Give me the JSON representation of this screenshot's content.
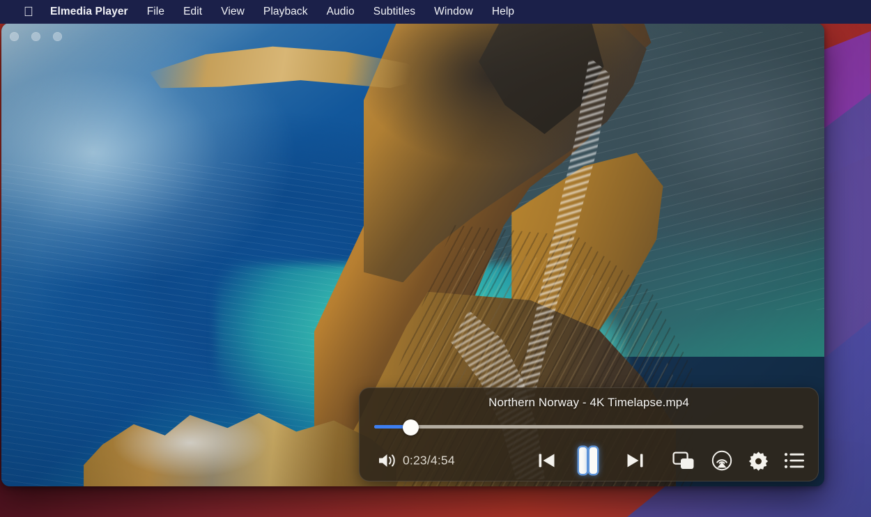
{
  "menubar": {
    "apple_icon": "apple-logo",
    "app_name": "Elmedia Player",
    "items": [
      {
        "label": "File"
      },
      {
        "label": "Edit"
      },
      {
        "label": "View"
      },
      {
        "label": "Playback"
      },
      {
        "label": "Audio"
      },
      {
        "label": "Subtitles"
      },
      {
        "label": "Window"
      },
      {
        "label": "Help"
      }
    ],
    "background_color": "#1b2049",
    "text_color": "#f2f3f7"
  },
  "window": {
    "traffic_lights": [
      "close",
      "minimize",
      "zoom"
    ],
    "video_description": "Aerial view of a Northern Norway coastline with deep blue water, turquoise shallows and golden cliffs"
  },
  "controls": {
    "title": "Northern Norway - 4K Timelapse.mp4",
    "seek": {
      "progress_percent": 8.5,
      "fill_color": "#3d7ff2",
      "track_color": "#b3aca0",
      "knob_color": "#fdfcf9"
    },
    "volume_icon": "volume-high-icon",
    "time": "0:23/4:54",
    "current_time": "0:23",
    "total_time": "4:54",
    "buttons": [
      {
        "name": "previous",
        "icon": "skip-previous-icon"
      },
      {
        "name": "playpause",
        "icon": "pause-icon",
        "state": "playing",
        "highlight_color": "#5f93d6"
      },
      {
        "name": "next",
        "icon": "skip-next-icon"
      },
      {
        "name": "pip",
        "icon": "picture-in-picture-icon"
      },
      {
        "name": "airplay",
        "icon": "airplay-icon"
      },
      {
        "name": "settings",
        "icon": "gear-icon"
      },
      {
        "name": "playlist",
        "icon": "playlist-icon"
      }
    ],
    "background_color": "#30271a",
    "text_color": "#f7f6f3"
  },
  "desktop": {
    "wallpaper_colors": [
      "#c6372c",
      "#b4302f",
      "#c33bbd",
      "#4a5aa8",
      "#5a4cb0"
    ]
  }
}
